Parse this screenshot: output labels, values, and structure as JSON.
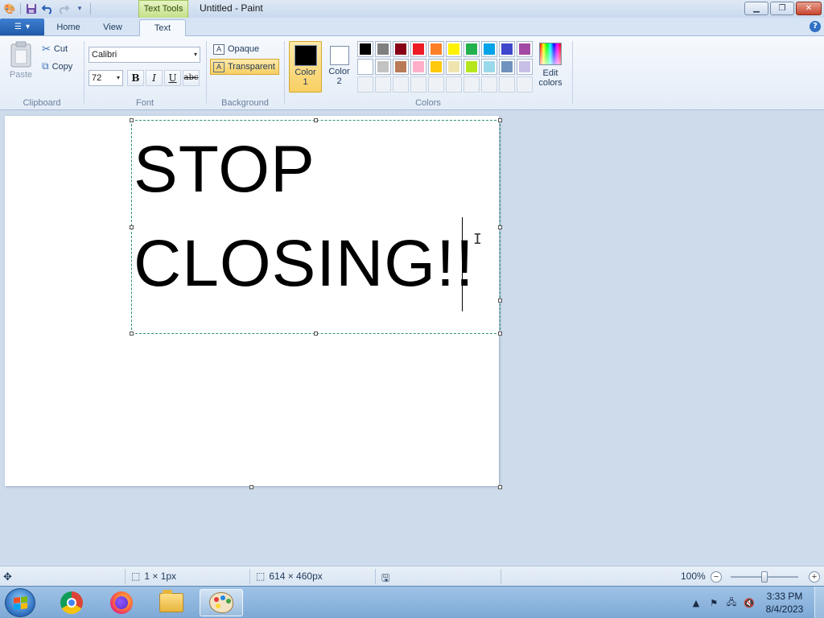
{
  "window": {
    "title": "Untitled - Paint",
    "context_tab": "Text Tools"
  },
  "tabs": [
    {
      "label": "Home"
    },
    {
      "label": "View"
    },
    {
      "label": "Text",
      "active": true
    }
  ],
  "clipboard": {
    "paste": "Paste",
    "cut": "Cut",
    "copy": "Copy",
    "group": "Clipboard"
  },
  "font": {
    "family": "Calibri",
    "size": "72",
    "bold": "B",
    "italic": "I",
    "underline": "U",
    "strikethrough": "abc",
    "group": "Font"
  },
  "background": {
    "opaque": "Opaque",
    "transparent": "Transparent",
    "selected": "transparent",
    "group": "Background"
  },
  "colors": {
    "color1_line1": "Color",
    "color1_line2": "1",
    "color1_value": "#000000",
    "color2_line1": "Color",
    "color2_line2": "2",
    "color2_value": "#ffffff",
    "edit_line1": "Edit",
    "edit_line2": "colors",
    "group": "Colors",
    "palette_row1": [
      "#000000",
      "#7f7f7f",
      "#880015",
      "#ed1c24",
      "#ff7f27",
      "#fff200",
      "#22b14c",
      "#00a2e8",
      "#3f48cc",
      "#a349a4"
    ],
    "palette_row2": [
      "#ffffff",
      "#c3c3c3",
      "#b97a57",
      "#ffaec9",
      "#ffc90e",
      "#efe4b0",
      "#b5e61d",
      "#99d9ea",
      "#7092be",
      "#c8bfe7"
    ],
    "palette_row3_empty": 10
  },
  "canvas": {
    "text_line1": "STOP",
    "text_line2": "CLOSING!!"
  },
  "status": {
    "selection_size": "1 × 1px",
    "image_size": "614 × 460px",
    "zoom": "100%",
    "zoom_minus": "−",
    "zoom_plus": "+"
  },
  "taskbar": {
    "time": "3:33 PM",
    "date": "8/4/2023"
  }
}
